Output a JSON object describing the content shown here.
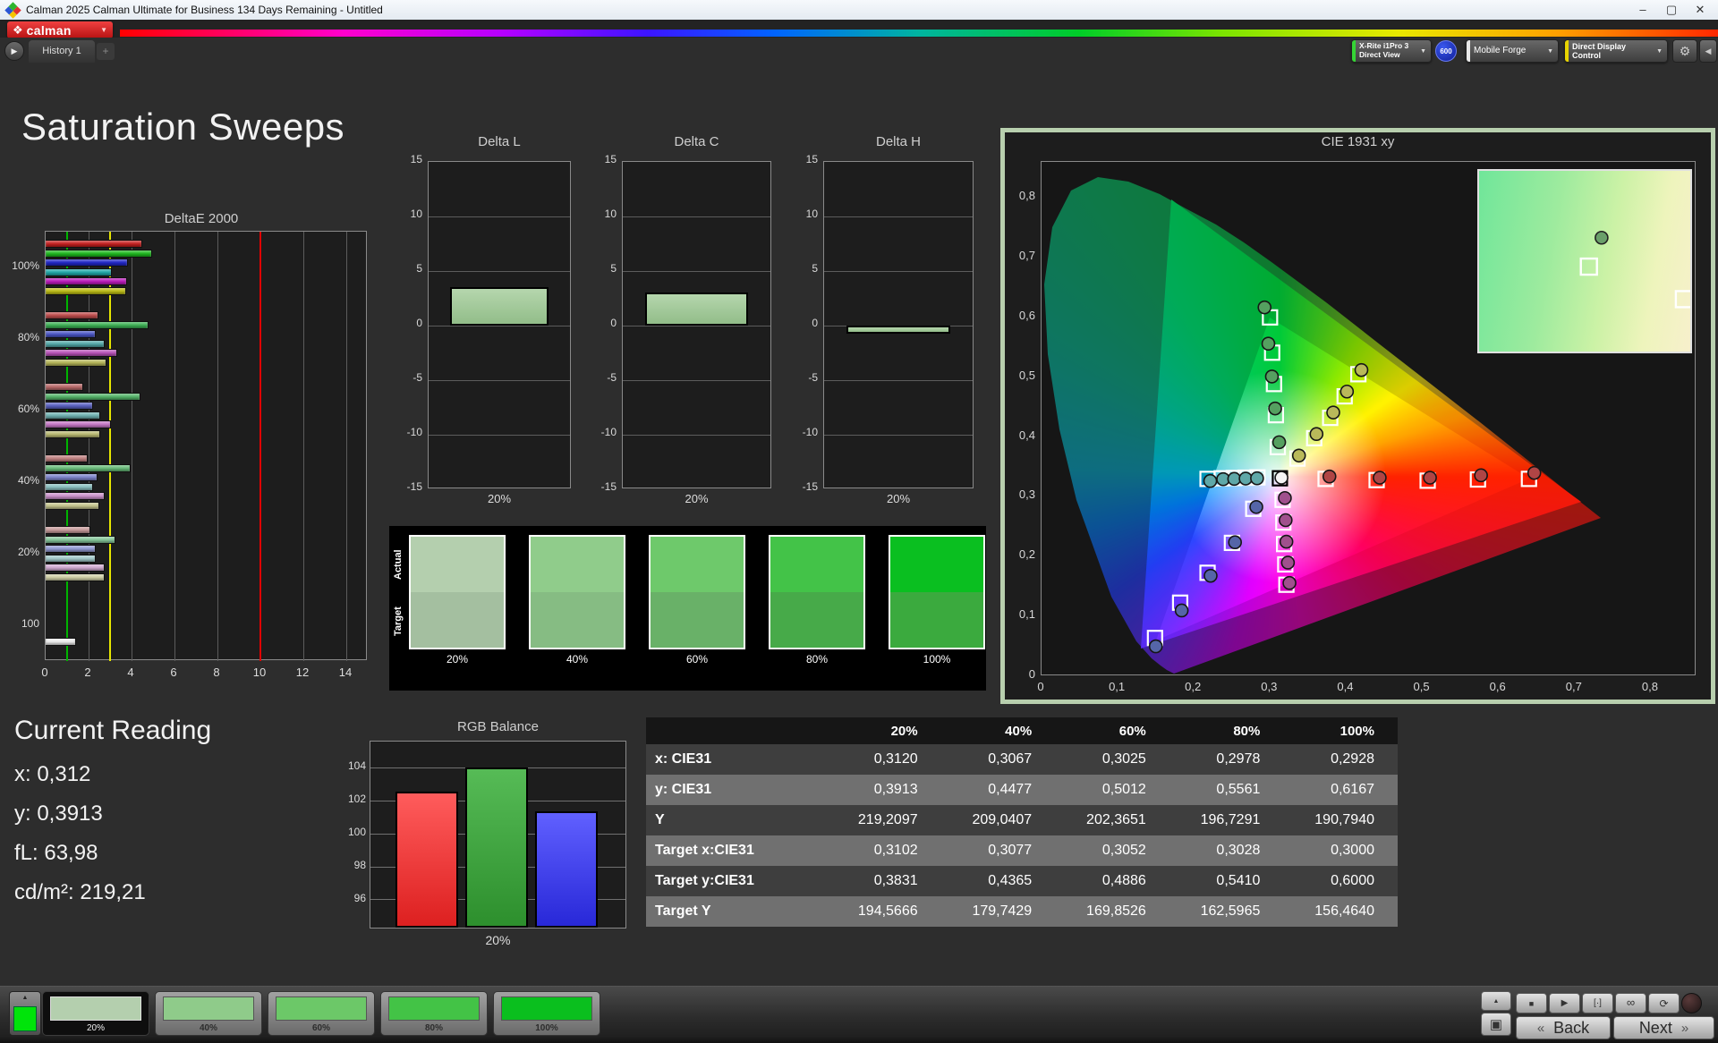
{
  "window": {
    "title": "Calman 2025 Calman Ultimate for Business 134 Days Remaining  - Untitled",
    "minimize": "–",
    "maximize": "▢",
    "close": "✕"
  },
  "brand": {
    "logo_text": "calman",
    "logo_diamond": "❖",
    "dropdown_chevron": "▼"
  },
  "tabs": {
    "pop_icon": "▶",
    "history": "History 1",
    "add": "+"
  },
  "toolbar": {
    "meter": {
      "line1": "X-Rite i1Pro 3",
      "line2": "Direct View",
      "accent": "#35d435"
    },
    "badge": "600",
    "source": {
      "label": "Mobile Forge",
      "accent": "#e8e8e8"
    },
    "display_control": {
      "label": "Direct Display Control",
      "accent": "#e8d400"
    },
    "gear_icon": "⚙",
    "collapse_icon": "◀",
    "chevron": "▼"
  },
  "page": {
    "title": "Saturation Sweeps"
  },
  "current_reading": {
    "title": "Current Reading",
    "lines": [
      "x: 0,312",
      "y: 0,3913",
      "fL: 63,98",
      "cd/m²: 219,21"
    ]
  },
  "swatches": {
    "actual_label": "Actual",
    "target_label": "Target",
    "items": [
      {
        "label": "20%",
        "actual": "#b4cfae",
        "target": "#a4bfa0"
      },
      {
        "label": "40%",
        "actual": "#90cc8b",
        "target": "#86bc83"
      },
      {
        "label": "60%",
        "actual": "#6ec96b",
        "target": "#69b168"
      },
      {
        "label": "80%",
        "actual": "#43c348",
        "target": "#47aa49"
      },
      {
        "label": "100%",
        "actual": "#0abf20",
        "target": "#3baa3e"
      }
    ]
  },
  "chart_data": [
    {
      "id": "deltae2000",
      "type": "bar",
      "orientation": "horizontal",
      "title": "DeltaE 2000",
      "xlim": [
        0,
        15
      ],
      "xticks": [
        0,
        2,
        4,
        6,
        8,
        10,
        12,
        14
      ],
      "grid": true,
      "reference_lines": [
        {
          "name": "green-ref",
          "value": 1,
          "color": "#00b400"
        },
        {
          "name": "yellow-ref",
          "value": 3,
          "color": "#e6e600"
        },
        {
          "name": "red-ref",
          "value": 10,
          "color": "#e00000"
        }
      ],
      "groups": [
        {
          "label": "100%",
          "values": [
            4.5,
            4.95,
            3.85,
            3.1,
            3.8,
            3.75
          ],
          "colors": [
            "#c51f1f",
            "#1db81d",
            "#2026c8",
            "#1fa8a8",
            "#bc1abc",
            "#bcbc16"
          ]
        },
        {
          "label": "80%",
          "values": [
            2.45,
            4.8,
            2.35,
            2.75,
            3.35,
            2.85
          ],
          "colors": [
            "#bf4d4d",
            "#3cb054",
            "#4a55c5",
            "#52a8a8",
            "#b852b8",
            "#b5b558"
          ]
        },
        {
          "label": "60%",
          "values": [
            1.75,
            4.4,
            2.2,
            2.55,
            3.05,
            2.55
          ],
          "colors": [
            "#b96a6a",
            "#54b469",
            "#5a62c2",
            "#6fb2b2",
            "#c678c6",
            "#b9b972"
          ]
        },
        {
          "label": "40%",
          "values": [
            1.95,
            3.95,
            2.4,
            2.2,
            2.75,
            2.5
          ],
          "colors": [
            "#c08080",
            "#67bb79",
            "#7d84cc",
            "#8abfbf",
            "#cc92cc",
            "#c4c48c"
          ]
        },
        {
          "label": "20%",
          "values": [
            2.1,
            3.25,
            2.35,
            2.35,
            2.75,
            2.75
          ],
          "colors": [
            "#c89c9c",
            "#86c79b",
            "#939ad4",
            "#a2caca",
            "#d2abd2",
            "#d0d0a6"
          ]
        },
        {
          "label": "100",
          "values": [
            1.4
          ],
          "colors": [
            "#ececec"
          ]
        }
      ]
    },
    {
      "id": "delta_l",
      "type": "bar",
      "title": "Delta L",
      "categories": [
        "20%"
      ],
      "values": [
        3.5
      ],
      "ylim": [
        -15,
        15
      ],
      "yticks": [
        15,
        10,
        5,
        0,
        -5,
        -10,
        -15
      ],
      "bar_color": "#a6cd9e"
    },
    {
      "id": "delta_c",
      "type": "bar",
      "title": "Delta C",
      "categories": [
        "20%"
      ],
      "values": [
        3.0
      ],
      "ylim": [
        -15,
        15
      ],
      "yticks": [
        15,
        10,
        5,
        0,
        -5,
        -10,
        -15
      ],
      "bar_color": "#a6cd9e"
    },
    {
      "id": "delta_h",
      "type": "bar",
      "title": "Delta H",
      "categories": [
        "20%"
      ],
      "values": [
        -0.7
      ],
      "ylim": [
        -15,
        15
      ],
      "yticks": [
        15,
        10,
        5,
        0,
        -5,
        -10,
        -15
      ],
      "bar_color": "#a6cd9e"
    },
    {
      "id": "cie1931",
      "type": "scatter",
      "title": "CIE 1931 xy",
      "xlim": [
        0,
        0.86
      ],
      "ylim": [
        0,
        0.86
      ],
      "xticks": [
        0,
        0.1,
        0.2,
        0.3,
        0.4,
        0.5,
        0.6,
        0.7,
        0.8
      ],
      "xtick_labels": [
        "0",
        "0,1",
        "0,2",
        "0,3",
        "0,4",
        "0,5",
        "0,6",
        "0,7",
        "0,8"
      ],
      "ytick_labels": [
        "0",
        "0,1",
        "0,2",
        "0,3",
        "0,4",
        "0,5",
        "0,6",
        "0,7",
        "0,8"
      ],
      "sweeps": [
        {
          "name": "green",
          "point_color": "#55a060",
          "measured": [
            [
              0.312,
              0.3913
            ],
            [
              0.3067,
              0.4477
            ],
            [
              0.3025,
              0.5012
            ],
            [
              0.2978,
              0.5561
            ],
            [
              0.2928,
              0.6167
            ]
          ],
          "target": [
            [
              0.3102,
              0.3831
            ],
            [
              0.3077,
              0.4365
            ],
            [
              0.3052,
              0.4886
            ],
            [
              0.3028,
              0.541
            ],
            [
              0.3,
              0.6
            ]
          ]
        },
        {
          "name": "red",
          "point_color": "#b04545",
          "measured": [
            [
              0.378,
              0.334
            ],
            [
              0.444,
              0.332
            ],
            [
              0.51,
              0.332
            ],
            [
              0.577,
              0.336
            ],
            [
              0.647,
              0.34
            ]
          ],
          "target": [
            [
              0.373,
              0.33
            ],
            [
              0.44,
              0.328
            ],
            [
              0.507,
              0.327
            ],
            [
              0.573,
              0.329
            ],
            [
              0.64,
              0.33
            ]
          ]
        },
        {
          "name": "blue",
          "point_color": "#5565a8",
          "measured": [
            [
              0.282,
              0.283
            ],
            [
              0.254,
              0.224
            ],
            [
              0.222,
              0.168
            ],
            [
              0.184,
              0.11
            ],
            [
              0.15,
              0.05
            ]
          ],
          "target": [
            [
              0.278,
              0.28
            ],
            [
              0.25,
              0.223
            ],
            [
              0.218,
              0.173
            ],
            [
              0.182,
              0.123
            ],
            [
              0.149,
              0.064
            ]
          ]
        },
        {
          "name": "cyan",
          "point_color": "#5fa8a8",
          "measured": [
            [
              0.2215,
              0.3265
            ],
            [
              0.2385,
              0.3295
            ],
            [
              0.253,
              0.33
            ],
            [
              0.268,
              0.3305
            ],
            [
              0.283,
              0.331
            ]
          ],
          "target": [
            [
              0.218,
              0.33
            ],
            [
              0.2365,
              0.331
            ],
            [
              0.2525,
              0.3315
            ],
            [
              0.268,
              0.332
            ],
            [
              0.2835,
              0.3325
            ]
          ]
        },
        {
          "name": "magenta",
          "point_color": "#a0508d",
          "measured": [
            [
              0.3195,
              0.298
            ],
            [
              0.3205,
              0.261
            ],
            [
              0.3215,
              0.225
            ],
            [
              0.3235,
              0.19
            ],
            [
              0.3255,
              0.156
            ]
          ],
          "target": [
            [
              0.3165,
              0.295
            ],
            [
              0.3175,
              0.257
            ],
            [
              0.3185,
              0.221
            ],
            [
              0.32,
              0.187
            ],
            [
              0.3215,
              0.153
            ]
          ]
        },
        {
          "name": "yellow",
          "point_color": "#b9b95a",
          "measured": [
            [
              0.42,
              0.512
            ],
            [
              0.401,
              0.476
            ],
            [
              0.383,
              0.441
            ],
            [
              0.361,
              0.405
            ],
            [
              0.338,
              0.369
            ]
          ],
          "target": [
            [
              0.416,
              0.505
            ],
            [
              0.398,
              0.468
            ],
            [
              0.379,
              0.432
            ],
            [
              0.358,
              0.398
            ],
            [
              0.336,
              0.364
            ]
          ]
        },
        {
          "name": "white",
          "point_color": "#f5f5f5",
          "target_stroke": "#000000",
          "measured": [
            [
              0.315,
              0.332
            ]
          ],
          "target": [
            [
              0.313,
              0.331
            ]
          ]
        }
      ],
      "inset": {
        "measured": [
          [
            0.58,
            0.37
          ]
        ],
        "targets": [
          [
            0.52,
            0.53
          ],
          [
            0.97,
            0.71
          ]
        ]
      }
    },
    {
      "id": "rgb_balance",
      "type": "bar",
      "title": "RGB Balance",
      "categories": [
        "20%"
      ],
      "ylim": [
        94.2,
        105.6
      ],
      "yticks": [
        104,
        102,
        100,
        98,
        96
      ],
      "series": [
        {
          "name": "Red",
          "value": 102.55,
          "color_top": "#ff5c5c",
          "color_bottom": "#dd2020"
        },
        {
          "name": "Green",
          "value": 104.05,
          "color_top": "#56bb56",
          "color_bottom": "#2d8f2d"
        },
        {
          "name": "Blue",
          "value": 101.35,
          "color_top": "#6060ff",
          "color_bottom": "#2828d8"
        }
      ]
    }
  ],
  "table": {
    "columns": [
      "",
      "20%",
      "40%",
      "60%",
      "80%",
      "100%"
    ],
    "rows": [
      {
        "label": "x: CIE31",
        "shade": "dark",
        "values": [
          "0,3120",
          "0,3067",
          "0,3025",
          "0,2978",
          "0,2928"
        ]
      },
      {
        "label": "y: CIE31",
        "shade": "lite",
        "values": [
          "0,3913",
          "0,4477",
          "0,5012",
          "0,5561",
          "0,6167"
        ]
      },
      {
        "label": "Y",
        "shade": "dark",
        "values": [
          "219,2097",
          "209,0407",
          "202,3651",
          "196,7291",
          "190,7940"
        ]
      },
      {
        "label": "Target x:CIE31",
        "shade": "lite",
        "values": [
          "0,3102",
          "0,3077",
          "0,3052",
          "0,3028",
          "0,3000"
        ]
      },
      {
        "label": "Target y:CIE31",
        "shade": "dark",
        "values": [
          "0,3831",
          "0,4365",
          "0,4886",
          "0,5410",
          "0,6000"
        ]
      },
      {
        "label": "Target Y",
        "shade": "lite",
        "values": [
          "194,5666",
          "179,7429",
          "169,8526",
          "162,5965",
          "156,4640"
        ]
      }
    ]
  },
  "footer": {
    "pattern_up_icon": "▲",
    "thumbnails": [
      {
        "label": "20%",
        "color": "#b4cfae",
        "selected": true
      },
      {
        "label": "40%",
        "color": "#8fcb8a",
        "selected": false
      },
      {
        "label": "60%",
        "color": "#6cc868",
        "selected": false
      },
      {
        "label": "80%",
        "color": "#43c346",
        "selected": false
      },
      {
        "label": "100%",
        "color": "#0abf1e",
        "selected": false
      }
    ],
    "transport": {
      "up_icon": "▲",
      "window_icon": "▣",
      "stop_icon": "■",
      "play_icon": "▶",
      "marker_icon": "[·]",
      "infinity_icon": "∞",
      "loop_icon": "⟳",
      "back_label": "Back",
      "back_chevron": "«",
      "next_label": "Next",
      "next_chevron": "»"
    }
  }
}
